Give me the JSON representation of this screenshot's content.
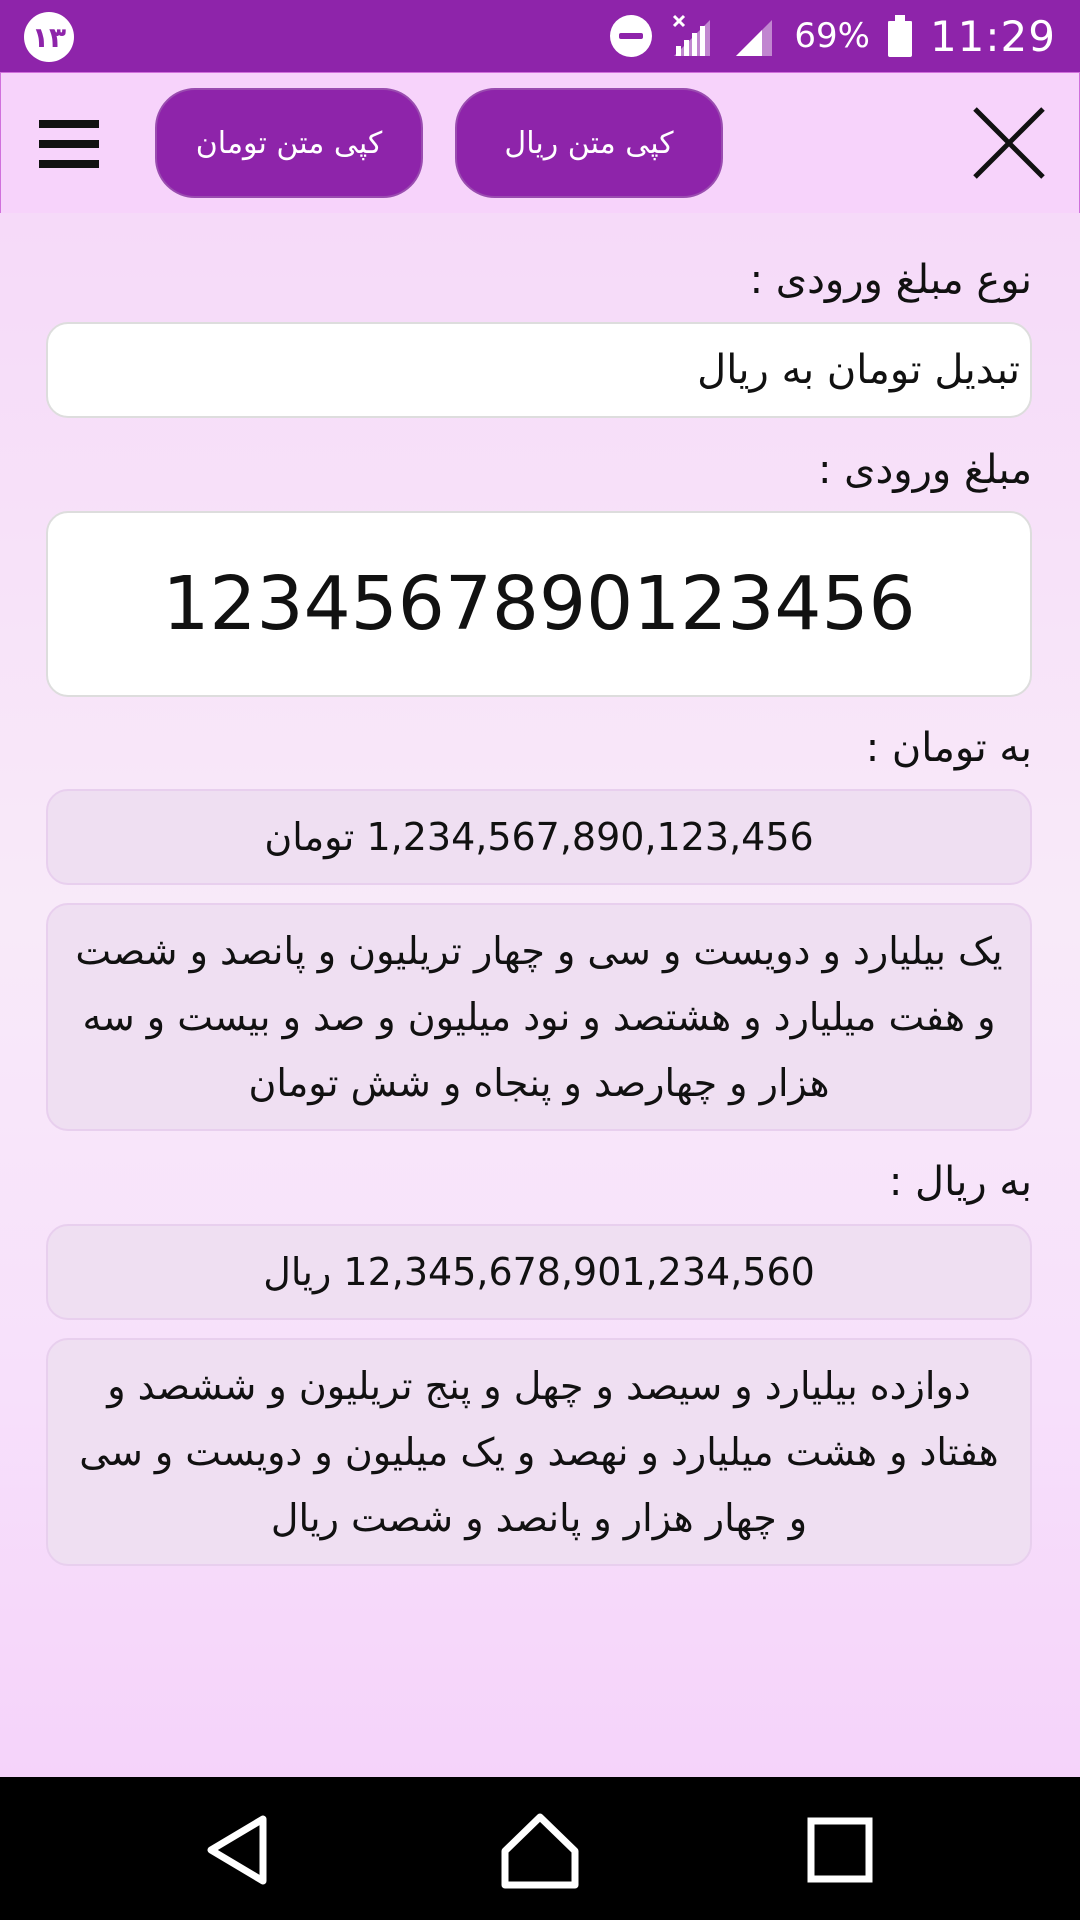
{
  "status_bar": {
    "notification_badge": "۱۳",
    "battery_percent": "69%",
    "time": "11:29"
  },
  "toolbar": {
    "copy_rial_label": "کپی متن ریال",
    "copy_toman_label": "کپی متن تومان"
  },
  "form": {
    "type_label": "نوع مبلغ ورودی :",
    "type_value": "تبدیل تومان به ریال",
    "amount_label": "مبلغ ورودی :",
    "amount_value": "1234567890123456"
  },
  "results": {
    "toman_label": "به تومان :",
    "toman_number": "1,234,567,890,123,456 تومان",
    "toman_words": "یک بیلیارد و دویست و سی و چهار تریلیون و پانصد و شصت و هفت میلیارد و هشتصد و نود میلیون و صد و بیست و سه هزار و چهارصد و پنجاه و شش تومان",
    "rial_label": "به ریال :",
    "rial_number": "12,345,678,901,234,560 ریال",
    "rial_words": "دوازده بیلیارد و سیصد و چهل و پنج تریلیون و ششصد و هفتاد و هشت میلیارد و نهصد و یک میلیون و دویست و سی و چهار هزار و پانصد و شصت ریال"
  },
  "colors": {
    "accent": "#8e24aa",
    "toolbar_bg": "#f7d3fb",
    "output_bg": "#efdff2"
  }
}
